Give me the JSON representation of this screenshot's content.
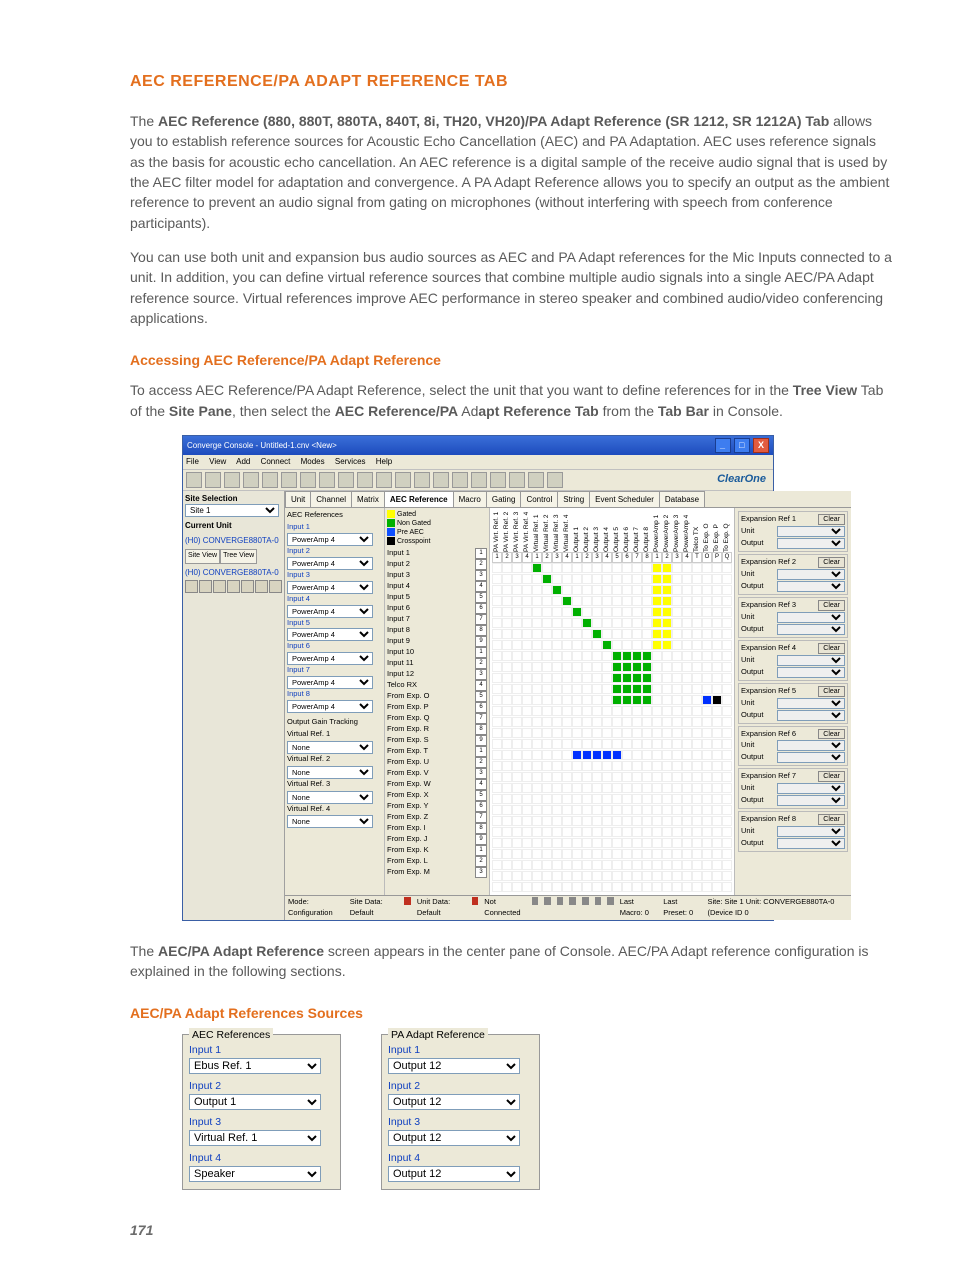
{
  "page_number": "171",
  "heading": "AEC REFERENCE/PA ADAPT REFERENCE TAB",
  "para1": {
    "lead": "The ",
    "bold1": "AEC Reference (880, 880T, 880TA, 840T, 8i, TH20, VH20)/PA Adapt Reference (SR 1212, SR 1212A) Tab",
    "rest": " allows you to establish reference sources for Acoustic Echo Cancellation (AEC) and PA Adaptation. AEC uses reference signals as the basis for acoustic echo cancellation. An AEC reference is a digital sample of the receive audio signal that is used by the AEC filter model for adaptation and convergence. A PA Adapt Reference allows you to specify an output as the ambient reference to prevent an audio signal from gating on microphones (without interfering with speech from conference participants)."
  },
  "para2": "You can use both unit and expansion bus audio sources as AEC and PA Adapt references for the Mic Inputs connected to a unit. In addition, you can define virtual reference sources that combine multiple audio signals into a single AEC/PA Adapt reference source. Virtual references improve AEC performance in stereo speaker and combined audio/video conferencing applications.",
  "sub1": "Accessing AEC Reference/PA Adapt Reference",
  "para3": {
    "t1": "To access AEC Reference/PA Adapt Reference, select the unit that you want to define references for in the ",
    "b1": "Tree View",
    "t2": " Tab of the ",
    "b2": "Site Pane",
    "t3": ", then select the ",
    "b3": "AEC Reference/PA",
    "t4": " Ad",
    "b4": "apt Reference Tab",
    "t5": " from the ",
    "b5": "Tab Bar",
    "t6": " in Console."
  },
  "para4": {
    "t1": "The ",
    "b1": "AEC/PA Adapt Reference",
    "t2": " screen appears in the center pane of Console. AEC/PA Adapt reference configuration is explained in the following sections."
  },
  "sub2": "AEC/PA Adapt References Sources",
  "app": {
    "title": "Converge Console - Untitled-1.cnv <New>",
    "menus": [
      "File",
      "View",
      "Add",
      "Connect",
      "Modes",
      "Services",
      "Help"
    ],
    "logo": "ClearOne",
    "site_selection_hdr": "Site Selection",
    "site_selection_val": "Site 1",
    "current_unit_hdr": "Current Unit",
    "current_unit_val": "(H0) CONVERGE880TA-0",
    "siteview": "Site View",
    "treeview": "Tree View",
    "tree_node": "(H0) CONVERGE880TA-0",
    "tabs": [
      "Unit",
      "Channel",
      "Matrix",
      "AEC Reference",
      "Macro",
      "Gating",
      "Control",
      "String",
      "Event Scheduler",
      "Database"
    ],
    "aec_refs_hdr": "AEC References",
    "inputs": [
      "Input 1",
      "Input 2",
      "Input 3",
      "Input 4",
      "Input 5",
      "Input 6",
      "Input 7",
      "Input 8"
    ],
    "input_val": "PowerAmp 4",
    "ogt_hdr": "Output Gain Tracking",
    "vrefs": [
      "Virtual Ref. 1",
      "Virtual Ref. 2",
      "Virtual Ref. 3",
      "Virtual Ref. 4"
    ],
    "vref_val": "None",
    "legend": {
      "gated": "Gated",
      "non_gated": "Non Gated",
      "pre_aec": "Pre AEC",
      "crosspoint": "Crosspoint"
    },
    "row_labels": [
      "Input 1",
      "Input 2",
      "Input 3",
      "Input 4",
      "Input 5",
      "Input 6",
      "Input 7",
      "Input 8",
      "Input 9",
      "Input 10",
      "Input 11",
      "Input 12",
      "Telco RX",
      "From Exp. O",
      "From Exp. P",
      "From Exp. Q",
      "From Exp. R",
      "From Exp. S",
      "From Exp. T",
      "From Exp. U",
      "From Exp. V",
      "From Exp. W",
      "From Exp. X",
      "From Exp. Y",
      "From Exp. Z",
      "From Exp. I",
      "From Exp. J",
      "From Exp. K",
      "From Exp. L",
      "From Exp. M"
    ],
    "col_labels": [
      "PA Virt. Ref. 1",
      "PA Virt. Ref. 2",
      "PA Virt. Ref. 3",
      "PA Virt. Ref. 4",
      "Virtual Ref. 1",
      "Virtual Ref. 2",
      "Virtual Ref. 3",
      "Virtual Ref. 4",
      "Output 1",
      "Output 2",
      "Output 3",
      "Output 4",
      "Output 5",
      "Output 6",
      "Output 7",
      "Output 8",
      "PowerAmp 1",
      "PowerAmp 2",
      "PowerAmp 3",
      "PowerAmp 4",
      "Telco TX",
      "To Exp. O",
      "To Exp. P",
      "To Exp. Q"
    ],
    "exp_refs": [
      {
        "name": "Expansion Ref 1"
      },
      {
        "name": "Expansion Ref 2"
      },
      {
        "name": "Expansion Ref 3"
      },
      {
        "name": "Expansion Ref 4"
      },
      {
        "name": "Expansion Ref 5"
      },
      {
        "name": "Expansion Ref 6"
      },
      {
        "name": "Expansion Ref 7"
      },
      {
        "name": "Expansion Ref 8"
      }
    ],
    "exp_unit": "Unit",
    "exp_output": "Output",
    "exp_clear": "Clear",
    "status": {
      "mode": "Mode: Configuration",
      "sitedata": "Site Data: Default",
      "unitdata": "Unit Data: Default",
      "conn": "Not Connected",
      "lastmacro": "Last Macro: 0",
      "lastpreset": "Last Preset: 0",
      "siteunit": "Site: Site 1   Unit: CONVERGE880TA-0 (Device ID 0"
    }
  },
  "forms": {
    "aec": {
      "title": "AEC References",
      "items": [
        {
          "label": "Input 1",
          "value": "Ebus Ref. 1"
        },
        {
          "label": "Input 2",
          "value": "Output 1"
        },
        {
          "label": "Input 3",
          "value": "Virtual Ref. 1"
        },
        {
          "label": "Input 4",
          "value": "Speaker"
        }
      ]
    },
    "pa": {
      "title": "PA Adapt Reference",
      "items": [
        {
          "label": "Input 1",
          "value": "Output 12"
        },
        {
          "label": "Input 2",
          "value": "Output 12"
        },
        {
          "label": "Input 3",
          "value": "Output 12"
        },
        {
          "label": "Input 4",
          "value": "Output 12"
        }
      ]
    }
  }
}
